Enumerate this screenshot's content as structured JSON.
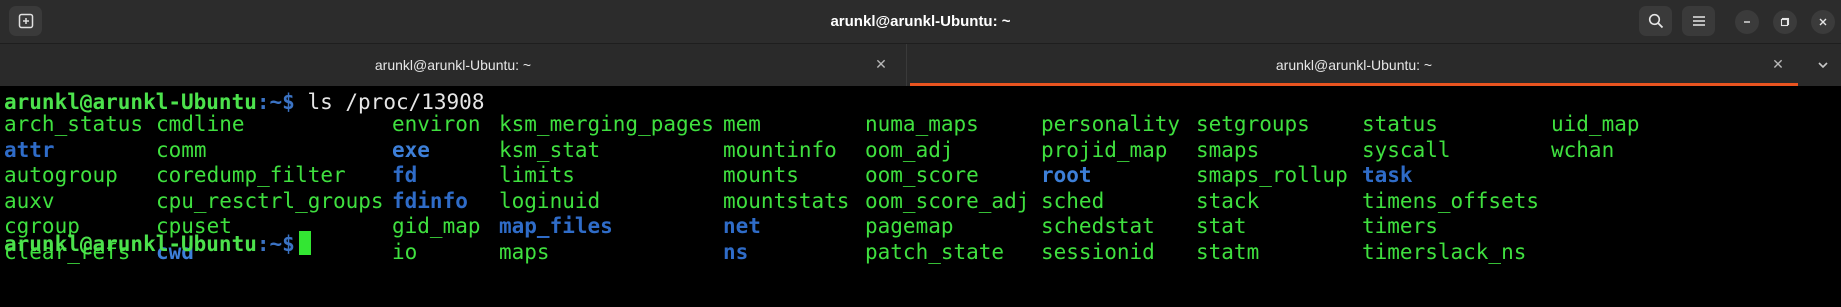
{
  "window": {
    "title": "arunkl@arunkl-Ubuntu: ~",
    "new_tab_icon": "new-tab-icon",
    "search_icon": "search-icon",
    "menu_icon": "hamburger-menu-icon",
    "minimize_icon": "minimize-icon",
    "maximize_icon": "maximize-icon",
    "close_icon": "close-icon"
  },
  "tabs": [
    {
      "label": "arunkl@arunkl-Ubuntu: ~",
      "active": false
    },
    {
      "label": "arunkl@arunkl-Ubuntu: ~",
      "active": true
    }
  ],
  "colors": {
    "accent": "#e95420",
    "prompt_green": "#4ce24c",
    "dir_blue": "#2f6cc8",
    "file_green": "#3fe03f"
  },
  "terminal": {
    "prompt_user": "arunkl@arunkl-Ubuntu",
    "prompt_path": ":~$",
    "command": " ls /proc/13908",
    "columns": [
      [
        {
          "name": "arch_status",
          "type": "file"
        },
        {
          "name": "attr",
          "type": "dir"
        },
        {
          "name": "autogroup",
          "type": "file"
        },
        {
          "name": "auxv",
          "type": "file"
        },
        {
          "name": "cgroup",
          "type": "file"
        },
        {
          "name": "clear_refs",
          "type": "file"
        }
      ],
      [
        {
          "name": "cmdline",
          "type": "file"
        },
        {
          "name": "comm",
          "type": "file"
        },
        {
          "name": "coredump_filter",
          "type": "file"
        },
        {
          "name": "cpu_resctrl_groups",
          "type": "file"
        },
        {
          "name": "cpuset",
          "type": "file"
        },
        {
          "name": "cwd",
          "type": "link"
        }
      ],
      [
        {
          "name": "environ",
          "type": "file"
        },
        {
          "name": "exe",
          "type": "link"
        },
        {
          "name": "fd",
          "type": "dir"
        },
        {
          "name": "fdinfo",
          "type": "dir"
        },
        {
          "name": "gid_map",
          "type": "file"
        },
        {
          "name": "io",
          "type": "file"
        }
      ],
      [
        {
          "name": "ksm_merging_pages",
          "type": "file"
        },
        {
          "name": "ksm_stat",
          "type": "file"
        },
        {
          "name": "limits",
          "type": "file"
        },
        {
          "name": "loginuid",
          "type": "file"
        },
        {
          "name": "map_files",
          "type": "dir"
        },
        {
          "name": "maps",
          "type": "file"
        }
      ],
      [
        {
          "name": "mem",
          "type": "file"
        },
        {
          "name": "mountinfo",
          "type": "file"
        },
        {
          "name": "mounts",
          "type": "file"
        },
        {
          "name": "mountstats",
          "type": "file"
        },
        {
          "name": "net",
          "type": "dir"
        },
        {
          "name": "ns",
          "type": "dir"
        }
      ],
      [
        {
          "name": "numa_maps",
          "type": "file"
        },
        {
          "name": "oom_adj",
          "type": "file"
        },
        {
          "name": "oom_score",
          "type": "file"
        },
        {
          "name": "oom_score_adj",
          "type": "file"
        },
        {
          "name": "pagemap",
          "type": "file"
        },
        {
          "name": "patch_state",
          "type": "file"
        }
      ],
      [
        {
          "name": "personality",
          "type": "file"
        },
        {
          "name": "projid_map",
          "type": "file"
        },
        {
          "name": "root",
          "type": "link"
        },
        {
          "name": "sched",
          "type": "file"
        },
        {
          "name": "schedstat",
          "type": "file"
        },
        {
          "name": "sessionid",
          "type": "file"
        }
      ],
      [
        {
          "name": "setgroups",
          "type": "file"
        },
        {
          "name": "smaps",
          "type": "file"
        },
        {
          "name": "smaps_rollup",
          "type": "file"
        },
        {
          "name": "stack",
          "type": "file"
        },
        {
          "name": "stat",
          "type": "file"
        },
        {
          "name": "statm",
          "type": "file"
        }
      ],
      [
        {
          "name": "status",
          "type": "file"
        },
        {
          "name": "syscall",
          "type": "file"
        },
        {
          "name": "task",
          "type": "dir"
        },
        {
          "name": "timens_offsets",
          "type": "file"
        },
        {
          "name": "timers",
          "type": "file"
        },
        {
          "name": "timerslack_ns",
          "type": "file"
        }
      ],
      [
        {
          "name": "uid_map",
          "type": "file"
        },
        {
          "name": "wchan",
          "type": "file"
        }
      ]
    ]
  }
}
